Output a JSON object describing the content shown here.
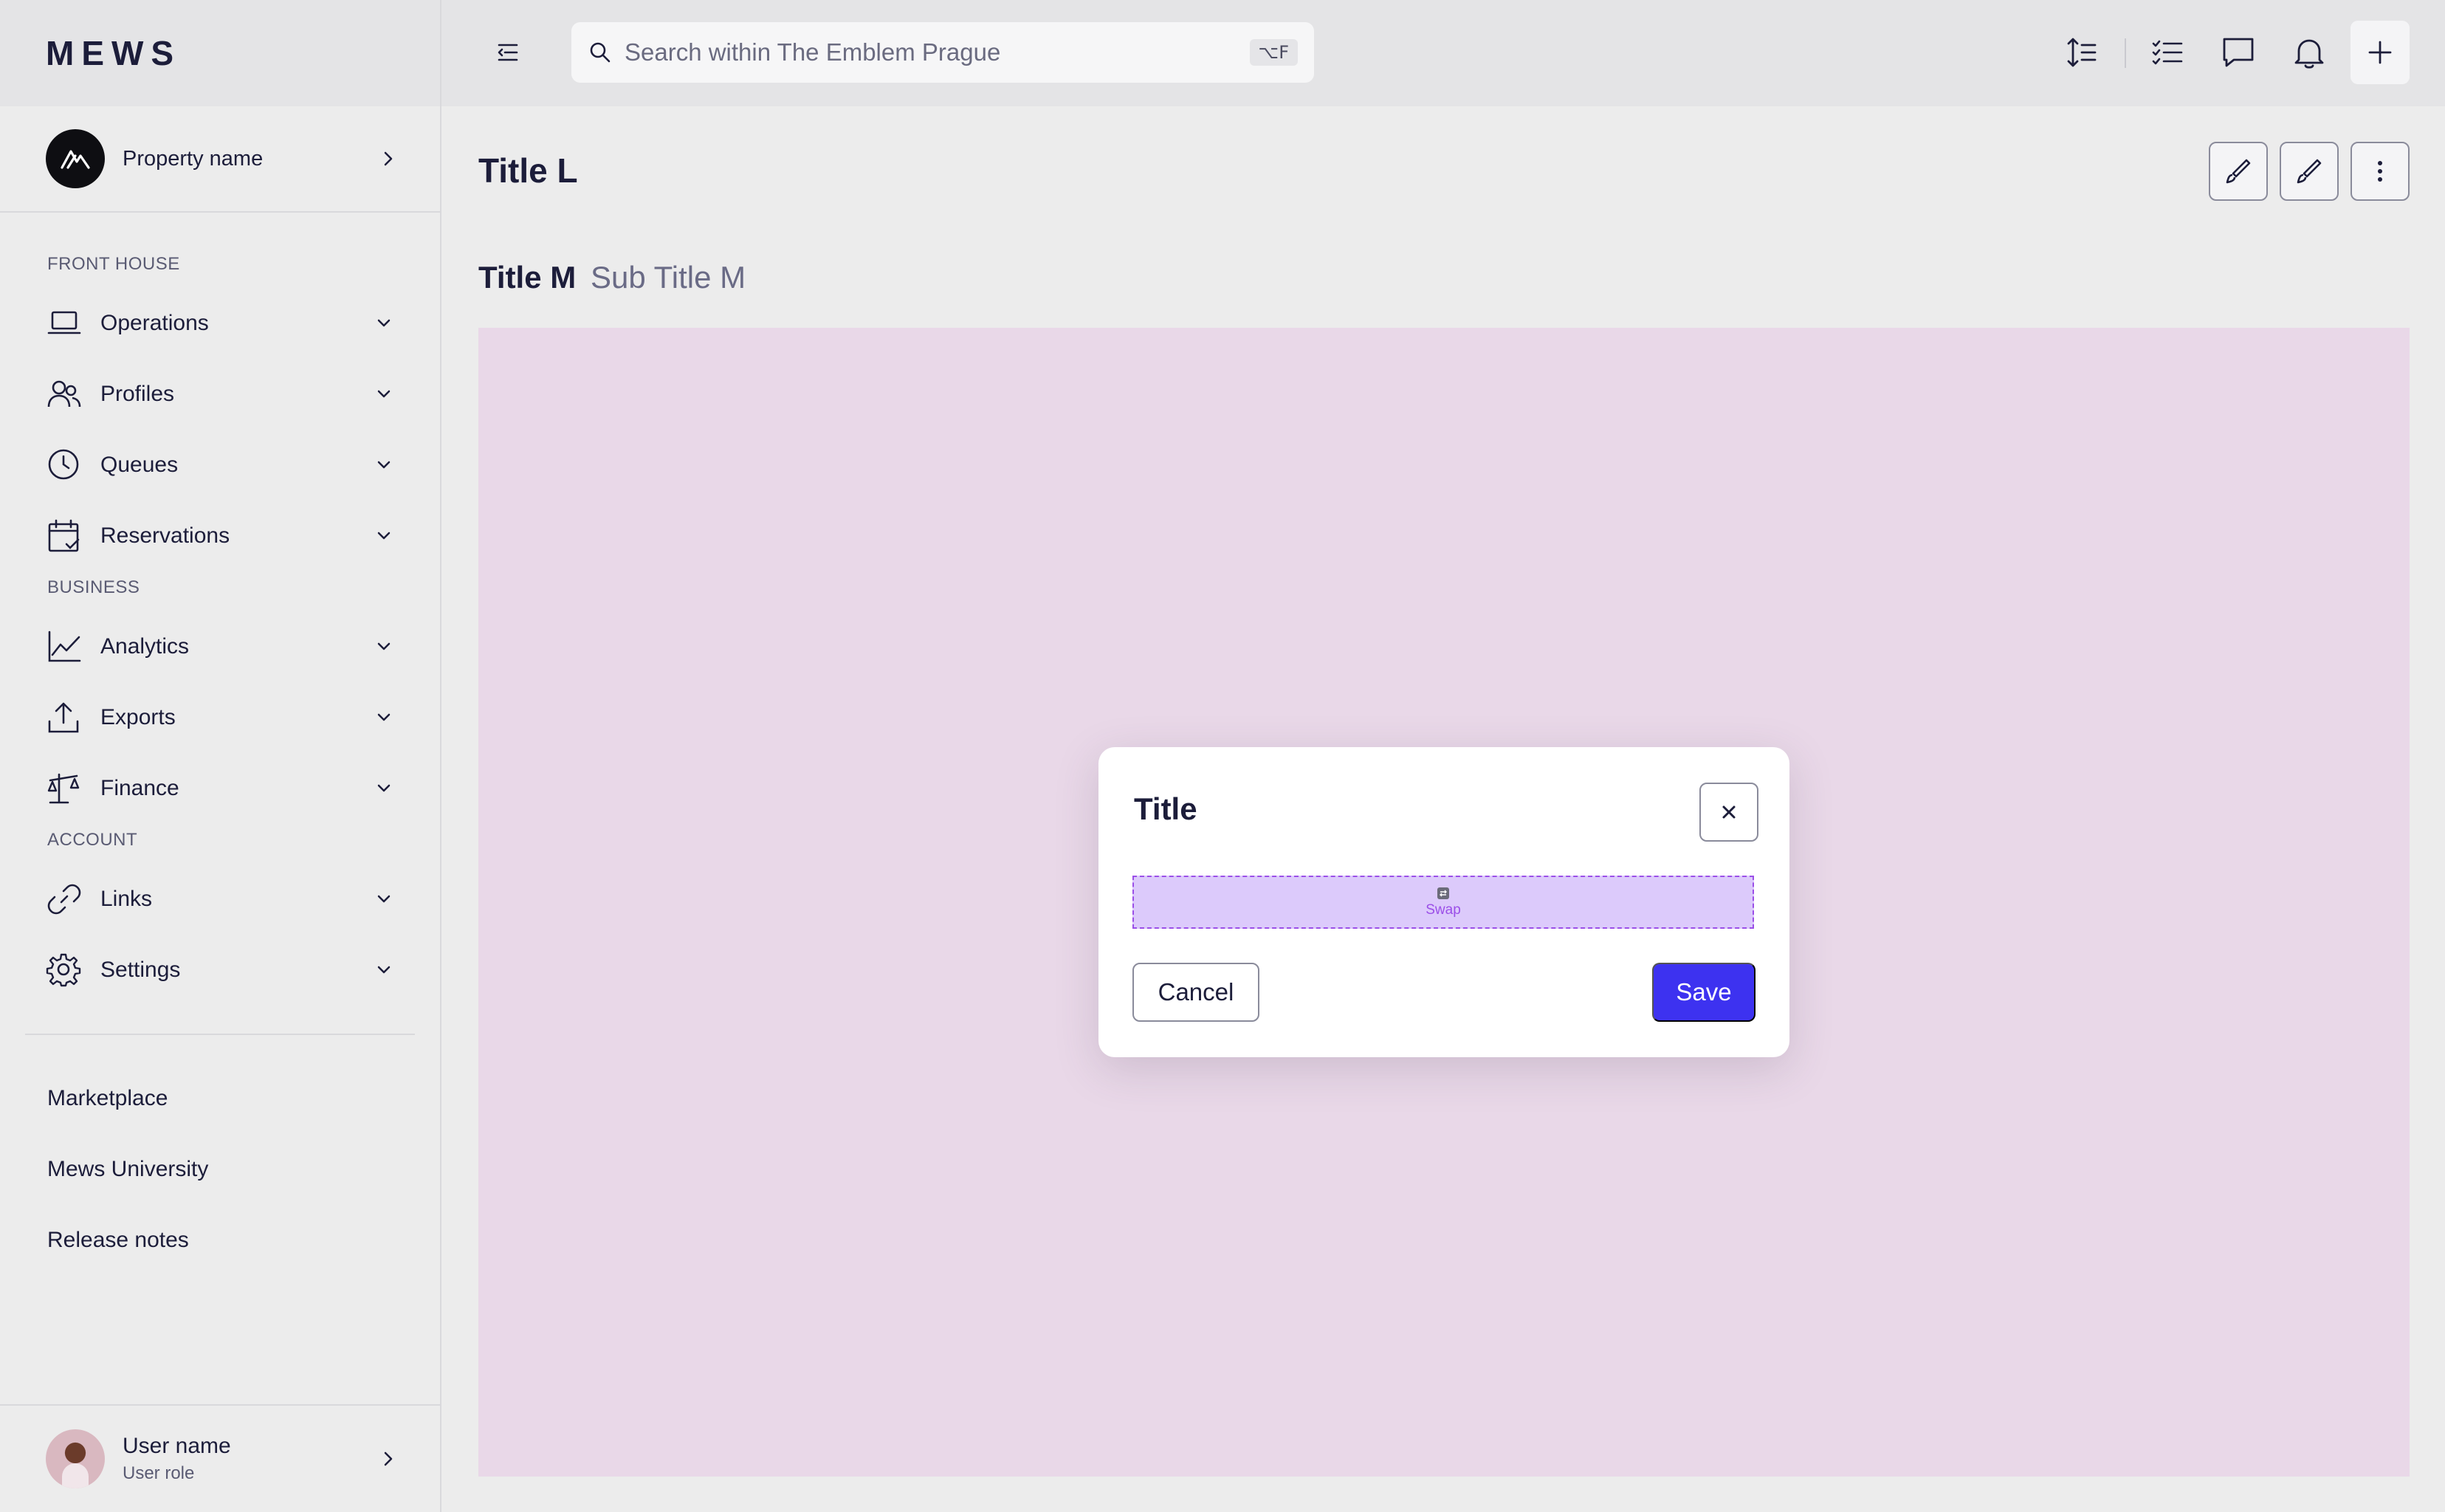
{
  "app": {
    "logo": "MEWS"
  },
  "property": {
    "name": "Property name"
  },
  "search": {
    "placeholder": "Search within The Emblem Prague",
    "shortcut": "⌥F"
  },
  "nav": {
    "sections": [
      {
        "label": "FRONT HOUSE",
        "items": [
          {
            "label": "Operations",
            "icon": "laptop-icon"
          },
          {
            "label": "Profiles",
            "icon": "users-icon"
          },
          {
            "label": "Queues",
            "icon": "clock-icon"
          },
          {
            "label": "Reservations",
            "icon": "calendar-check-icon"
          }
        ]
      },
      {
        "label": "BUSINESS",
        "items": [
          {
            "label": "Analytics",
            "icon": "chart-line-icon"
          },
          {
            "label": "Exports",
            "icon": "upload-icon"
          },
          {
            "label": "Finance",
            "icon": "scale-icon"
          }
        ]
      },
      {
        "label": "ACCOUNT",
        "items": [
          {
            "label": "Links",
            "icon": "link-icon"
          },
          {
            "label": "Settings",
            "icon": "gear-icon"
          }
        ]
      }
    ],
    "links": [
      "Marketplace",
      "Mews University",
      "Release notes"
    ]
  },
  "user": {
    "name": "User name",
    "role": "User role"
  },
  "page": {
    "title": "Title L",
    "section_title": "Title M",
    "section_subtitle": "Sub Title M"
  },
  "modal": {
    "title": "Title",
    "placeholder_label": "Swap",
    "cancel": "Cancel",
    "save": "Save"
  },
  "colors": {
    "primary": "#3d32f0",
    "canvas": "#e9d8e8",
    "swap_fill": "#dccafb",
    "swap_border": "#9b4fe8",
    "background": "#ececec",
    "topbar": "#e4e4e6"
  }
}
